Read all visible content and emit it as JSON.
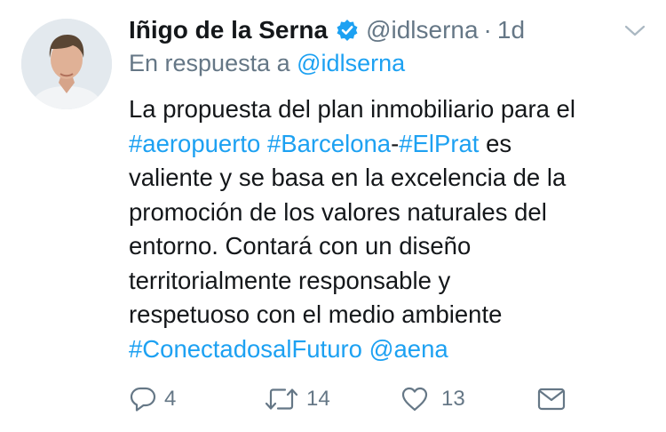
{
  "tweet": {
    "author_name": "Iñigo de la Serna",
    "handle": "@idlserna",
    "separator": "·",
    "time": "1d",
    "reply_prefix": "En respuesta a",
    "reply_to": "@idlserna",
    "body": {
      "l1": "La propuesta del plan inmobiliario para el",
      "l2_tag1": "#aeropuerto",
      "l2_tag2": "#Barcelona",
      "l2_dash": "-",
      "l2_tag3": "#ElPrat",
      "l2_rest": "es",
      "l3": "valiente y se basa en la excelencia de la",
      "l4": "promoción de los valores naturales del",
      "l5": "entorno. Contará con un diseño",
      "l6": "territorialmente responsable y",
      "l7": "respetuoso con el medio ambiente",
      "l8_tag": "#ConectadosalFuturo",
      "l8_mention": "@aena"
    },
    "actions": {
      "reply_count": "4",
      "retweet_count": "14",
      "like_count": "13"
    }
  },
  "icons": {
    "verified": "verified-badge-icon",
    "menu": "chevron-down-icon",
    "reply": "reply-icon",
    "retweet": "retweet-icon",
    "like": "heart-icon",
    "message": "envelope-icon"
  },
  "colors": {
    "link": "#1da1f2",
    "secondary": "#657786",
    "text": "#14171a",
    "verified": "#1da1f2"
  }
}
